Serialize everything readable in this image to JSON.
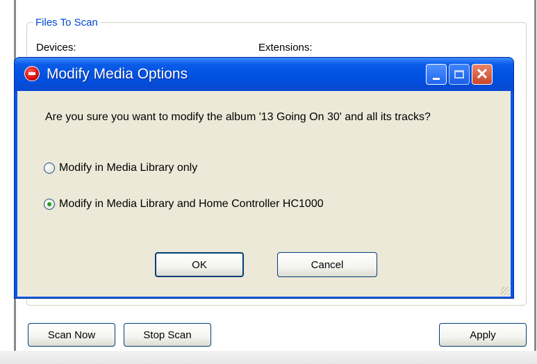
{
  "background": {
    "group_title": "Files To Scan",
    "devices_label": "Devices:",
    "extensions_label": "Extensions:",
    "scan_now_label": "Scan Now",
    "stop_scan_label": "Stop Scan",
    "apply_label": "Apply"
  },
  "dialog": {
    "title": "Modify Media Options",
    "message": "Are you sure you want to modify the album '13 Going On 30' and all its tracks?",
    "options": [
      {
        "label": "Modify in Media Library only",
        "checked": false
      },
      {
        "label": "Modify in Media Library and Home Controller HC1000",
        "checked": true
      }
    ],
    "ok_label": "OK",
    "cancel_label": "Cancel"
  },
  "colors": {
    "titlebar": "#0a57e3",
    "dialog_body": "#ece9d8",
    "group_title": "#0046d5",
    "close_button": "#c9462c"
  }
}
